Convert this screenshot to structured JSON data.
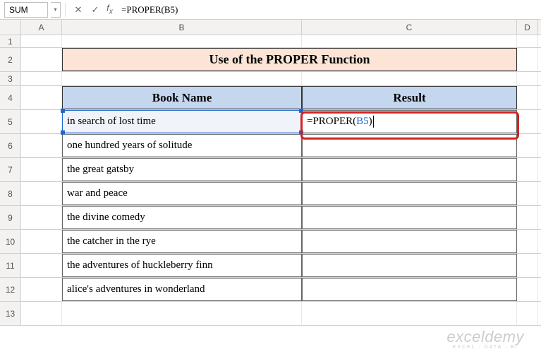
{
  "name_box": "SUM",
  "formula_bar": "=PROPER(B5)",
  "columns": [
    "A",
    "B",
    "C",
    "D"
  ],
  "rows": [
    "1",
    "2",
    "3",
    "4",
    "5",
    "6",
    "7",
    "8",
    "9",
    "10",
    "11",
    "12",
    "13"
  ],
  "title": "Use of the PROPER Function",
  "headers": {
    "book": "Book Name",
    "result": "Result"
  },
  "books": [
    "in search of lost time",
    "one hundred years of solitude",
    "the great gatsby",
    "war and peace",
    "the divine comedy",
    "the catcher in the rye",
    "the adventures of huckleberry finn",
    "alice's adventures in wonderland"
  ],
  "c5_formula_prefix": "=PROPER(",
  "c5_formula_ref": "B5",
  "c5_formula_suffix": ")",
  "watermark": {
    "main": "exceldemy",
    "sub": "EXCEL · DATA · BI"
  },
  "icons": {
    "cancel": "✕",
    "enter": "✓",
    "dropdown": "▾"
  }
}
